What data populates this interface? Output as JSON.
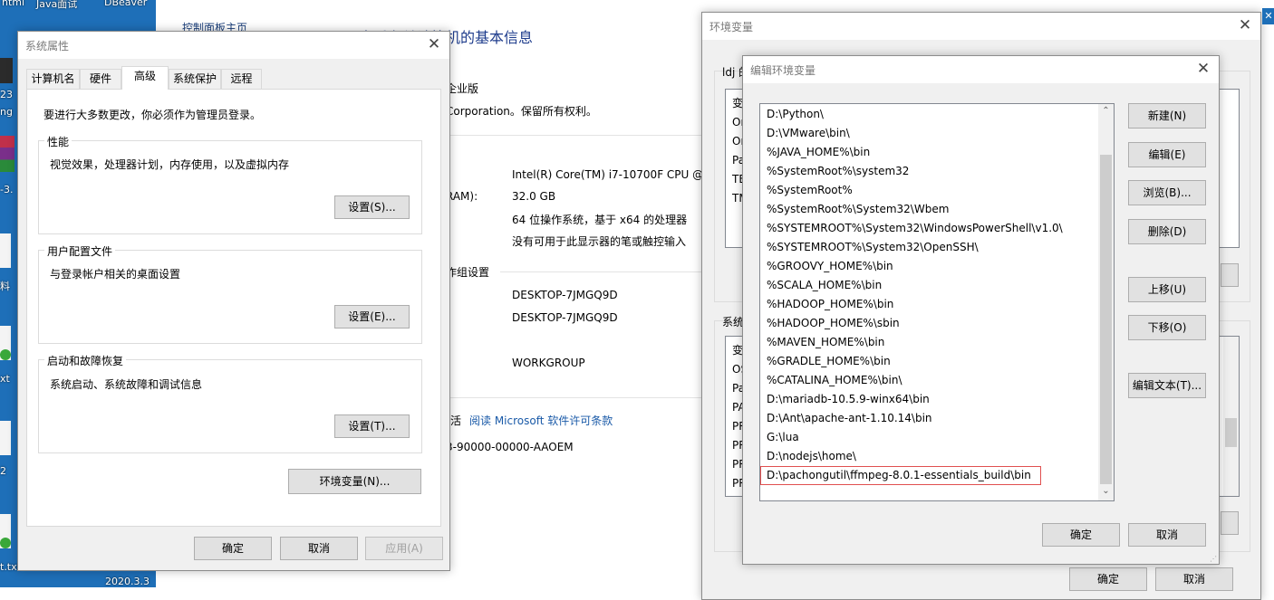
{
  "desktop": {
    "labels": [
      "ntml",
      "Java面试",
      "DBeaver",
      "23",
      "ng",
      "-3.",
      "料",
      "xt",
      "2",
      "t.txt",
      "2020.3.3"
    ]
  },
  "sysinfo": {
    "breadcrumb": "控制面板主页",
    "heading": "查看有关计算机的基本信息",
    "edition_frag": "企业版",
    "corp_frag": "Corporation。保留所有权利。",
    "cpu": "Intel(R) Core(TM) i7-10700F CPU @ 2",
    "ram_label_frag": "RAM):",
    "ram": "32.0 GB",
    "systype": "64 位操作系统，基于 x64 的处理器",
    "pen": "没有可用于此显示器的笔或触控输入",
    "workgroup_settings_frag": "作组设置",
    "computer_name": "DESKTOP-7JMGQ9D",
    "full_name": "DESKTOP-7JMGQ9D",
    "workgroup": "WORKGROUP",
    "activation_frag": "活",
    "license_link": "阅读 Microsoft 软件许可条款",
    "product_id_frag": "3-90000-00000-AAOEM"
  },
  "sysprops": {
    "title": "系统属性",
    "tabs": [
      "计算机名",
      "硬件",
      "高级",
      "系统保护",
      "远程"
    ],
    "admin_note": "要进行大多数更改，你必须作为管理员登录。",
    "performance": {
      "label": "性能",
      "desc": "视觉效果，处理器计划，内存使用，以及虚拟内存",
      "button": "设置(S)..."
    },
    "profiles": {
      "label": "用户配置文件",
      "desc": "与登录帐户相关的桌面设置",
      "button": "设置(E)..."
    },
    "startup": {
      "label": "启动和故障恢复",
      "desc": "系统启动、系统故障和调试信息",
      "button": "设置(T)..."
    },
    "env_button": "环境变量(N)...",
    "ok": "确定",
    "cancel": "取消",
    "apply": "应用(A)"
  },
  "envvars": {
    "title": "环境变量",
    "user_section_frag": "ldj 的",
    "user_rows_frag": [
      "变",
      "On",
      "On",
      "Pa",
      "TE",
      "TM"
    ],
    "system_section_frag": "系统",
    "system_rows_frag": [
      "变",
      "OS",
      "Pa",
      "PA",
      "PR",
      "PR",
      "PR",
      "PR"
    ],
    "ok": "确定",
    "cancel": "取消"
  },
  "editenv": {
    "title": "编辑环境变量",
    "paths": [
      "D:\\Python\\",
      "D:\\VMware\\bin\\",
      "%JAVA_HOME%\\bin",
      "%SystemRoot%\\system32",
      "%SystemRoot%",
      "%SystemRoot%\\System32\\Wbem",
      "%SYSTEMROOT%\\System32\\WindowsPowerShell\\v1.0\\",
      "%SYSTEMROOT%\\System32\\OpenSSH\\",
      "%GROOVY_HOME%\\bin",
      "%SCALA_HOME%\\bin",
      "%HADOOP_HOME%\\bin",
      "%HADOOP_HOME%\\sbin",
      "%MAVEN_HOME%\\bin",
      "%GRADLE_HOME%\\bin",
      "%CATALINA_HOME%\\bin\\",
      "D:\\mariadb-10.5.9-winx64\\bin",
      "D:\\Ant\\apache-ant-1.10.14\\bin",
      "G:\\lua",
      "D:\\nodejs\\home\\",
      "D:\\pachongutil\\ffmpeg-8.0.1-essentials_build\\bin"
    ],
    "selected_index": 19,
    "buttons": {
      "new": "新建(N)",
      "edit": "编辑(E)",
      "browse": "浏览(B)...",
      "delete": "删除(D)",
      "up": "上移(U)",
      "down": "下移(O)",
      "edit_text": "编辑文本(T)..."
    },
    "ok": "确定",
    "cancel": "取消",
    "highlight_color": "#e05050"
  }
}
